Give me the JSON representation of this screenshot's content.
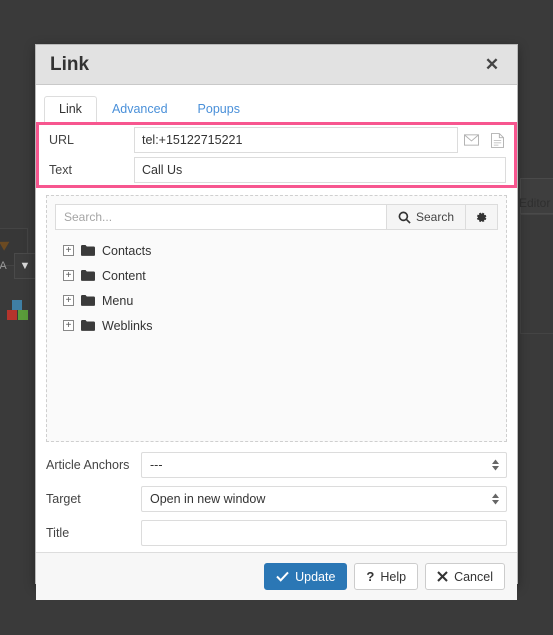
{
  "background": {
    "editor_label": "Editor",
    "toolbar_icons": [
      "pencil-icon",
      "font-size-dropdown",
      "color-blocks-icon"
    ]
  },
  "modal": {
    "title": "Link",
    "close_icon": "close-icon",
    "tabs": [
      {
        "label": "Link",
        "active": true
      },
      {
        "label": "Advanced",
        "active": false
      },
      {
        "label": "Popups",
        "active": false
      }
    ],
    "link_fields": {
      "url": {
        "label": "URL",
        "value": "tel:+15122715221",
        "placeholder": "",
        "icons": [
          "mail-icon",
          "page-icon"
        ]
      },
      "text": {
        "label": "Text",
        "value": "Call Us",
        "placeholder": ""
      },
      "highlight_color": "#f7568f"
    },
    "browser": {
      "search_placeholder": "Search...",
      "search_value": "",
      "search_button_label": "Search",
      "search_icon": "search-icon",
      "options_icon": "gear-icon",
      "tree": [
        {
          "label": "Contacts",
          "expander": "+",
          "icon": "folder-icon"
        },
        {
          "label": "Content",
          "expander": "+",
          "icon": "folder-icon"
        },
        {
          "label": "Menu",
          "expander": "+",
          "icon": "folder-icon"
        },
        {
          "label": "Weblinks",
          "expander": "+",
          "icon": "folder-icon"
        }
      ]
    },
    "options": {
      "article_anchors": {
        "label": "Article Anchors",
        "value": "---"
      },
      "target": {
        "label": "Target",
        "value": "Open in new window"
      },
      "title": {
        "label": "Title",
        "value": "",
        "placeholder": ""
      }
    },
    "footer": {
      "update_label": "Update",
      "help_label": "Help",
      "cancel_label": "Cancel",
      "update_icon": "check-icon",
      "help_icon": "question-icon",
      "cancel_icon": "x-icon",
      "primary_color": "#2b77b5"
    }
  }
}
